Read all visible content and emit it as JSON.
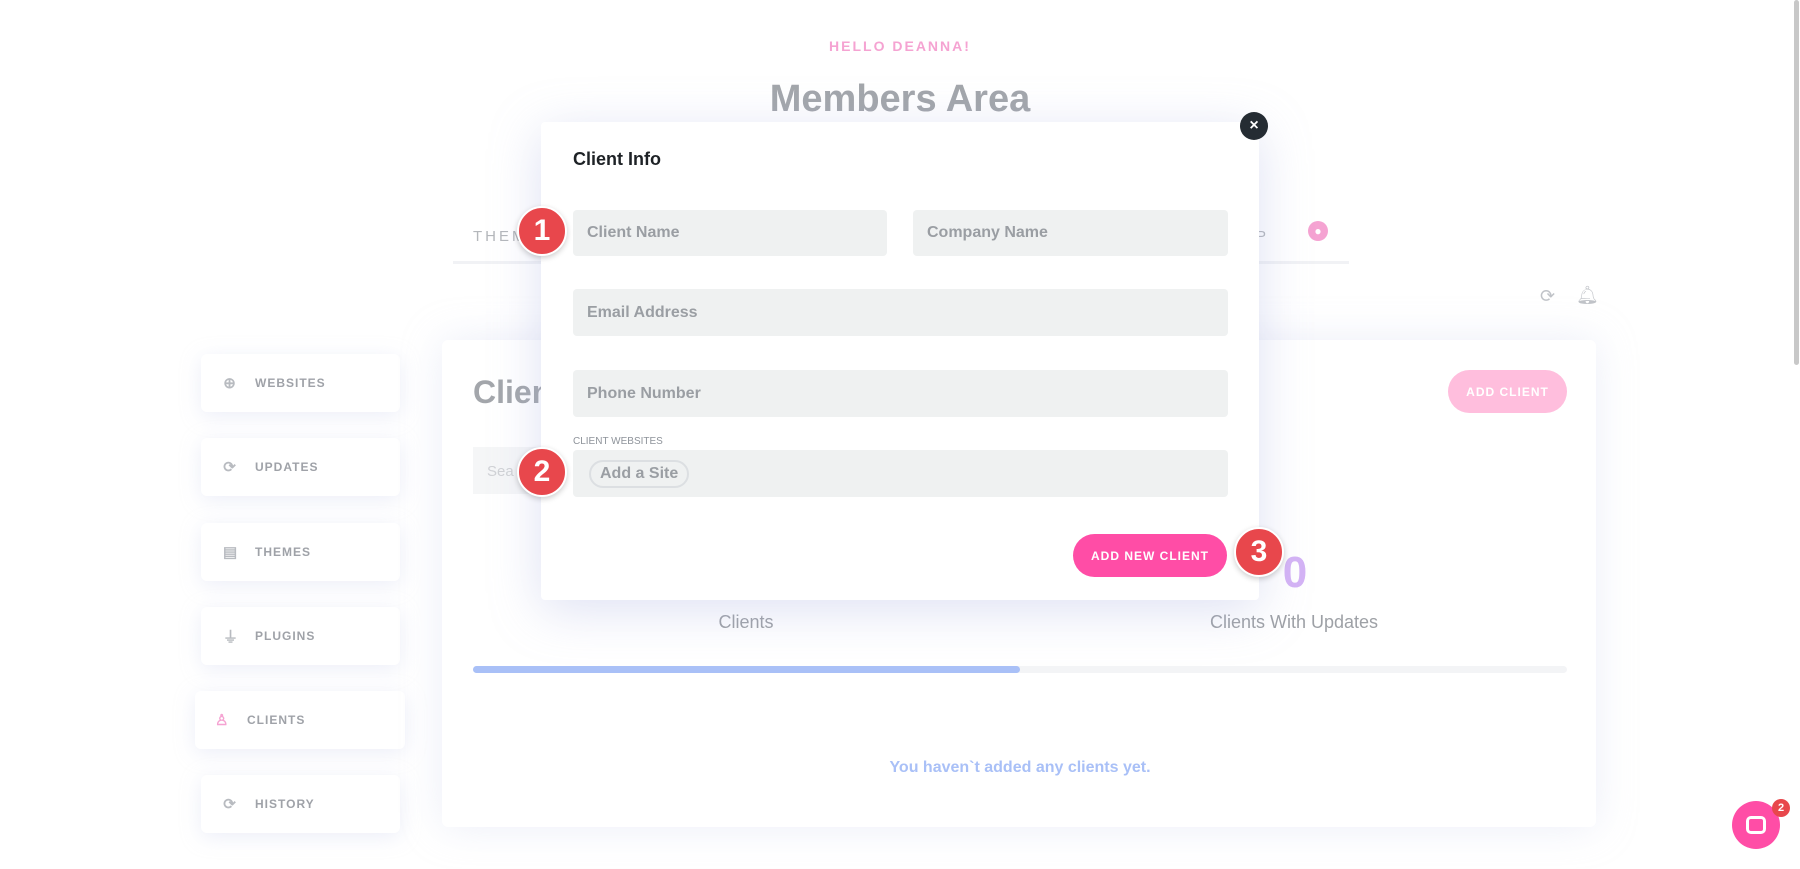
{
  "header": {
    "greeting": "HELLO DEANNA!",
    "title": "Members Area"
  },
  "nav": {
    "tab_left_partial": "THEM",
    "tab_right_partial": "P"
  },
  "sidebar": {
    "items": [
      {
        "label": "WEBSITES",
        "icon": "globe-icon"
      },
      {
        "label": "UPDATES",
        "icon": "refresh-icon"
      },
      {
        "label": "THEMES",
        "icon": "layout-icon"
      },
      {
        "label": "PLUGINS",
        "icon": "plug-icon"
      },
      {
        "label": "CLIENTS",
        "icon": "user-icon",
        "active": true
      },
      {
        "label": "HISTORY",
        "icon": "refresh-icon"
      }
    ]
  },
  "main": {
    "title_partial": "Clien",
    "search_partial": "Sea",
    "add_client": "ADD CLIENT",
    "stats": [
      {
        "value": "",
        "label": "Clients"
      },
      {
        "value": "0",
        "label": "Clients With Updates"
      }
    ],
    "progress": 0.5,
    "empty": "You haven`t added any clients yet."
  },
  "modal": {
    "title": "Client Info",
    "client_name_placeholder": "Client Name",
    "company_name_placeholder": "Company Name",
    "email_placeholder": "Email Address",
    "phone_placeholder": "Phone Number",
    "websites_label": "CLIENT WEBSITES",
    "add_site": "Add a Site",
    "submit": "ADD NEW CLIENT"
  },
  "annotations": [
    "1",
    "2",
    "3"
  ],
  "chat": {
    "unread": "2"
  },
  "colors": {
    "accent": "#ff4da6",
    "annotation": "#e8474c",
    "progress": "#a9c0f7"
  }
}
